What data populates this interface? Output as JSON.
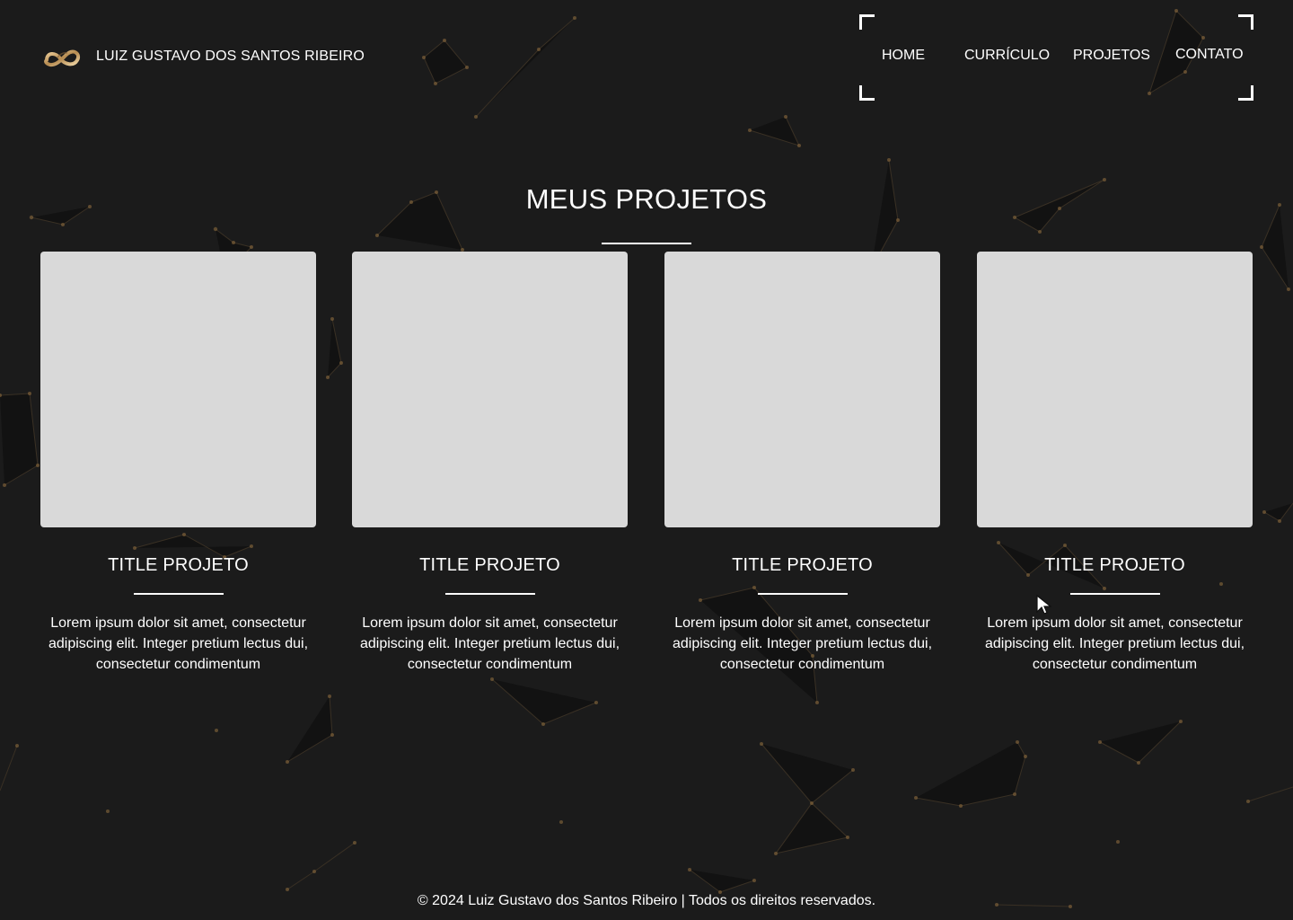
{
  "colors": {
    "background": "#1b1b1b",
    "text": "#ffffff",
    "placeholder": "#d9d9d9",
    "network_accent": "#8b6a3d",
    "logo_gold": "#d9b57b"
  },
  "header": {
    "brand_name": "LUIZ GUSTAVO DOS SANTOS RIBEIRO",
    "logo_icon": "infinity-logo-icon",
    "nav": [
      {
        "label": "HOME"
      },
      {
        "label": "CURRÍCULO"
      },
      {
        "label": "PROJETOS"
      },
      {
        "label": "CONTATO"
      }
    ]
  },
  "main": {
    "title": "MEUS PROJETOS",
    "projects": [
      {
        "title": "TITLE PROJETO",
        "description": "Lorem ipsum dolor sit amet, consectetur adipiscing elit. Integer pretium lectus dui, consectetur condimentum"
      },
      {
        "title": "TITLE PROJETO",
        "description": "Lorem ipsum dolor sit amet, consectetur adipiscing elit. Integer pretium lectus dui, consectetur condimentum"
      },
      {
        "title": "TITLE PROJETO",
        "description": "Lorem ipsum dolor sit amet, consectetur adipiscing elit. Integer pretium lectus dui, consectetur condimentum"
      },
      {
        "title": "TITLE PROJETO",
        "description": "Lorem ipsum dolor sit amet, consectetur adipiscing elit. Integer pretium lectus dui, consectetur condimentum"
      }
    ]
  },
  "footer": {
    "text": "© 2024 Luiz Gustavo dos Santos Ribeiro | Todos os direitos reservados."
  }
}
